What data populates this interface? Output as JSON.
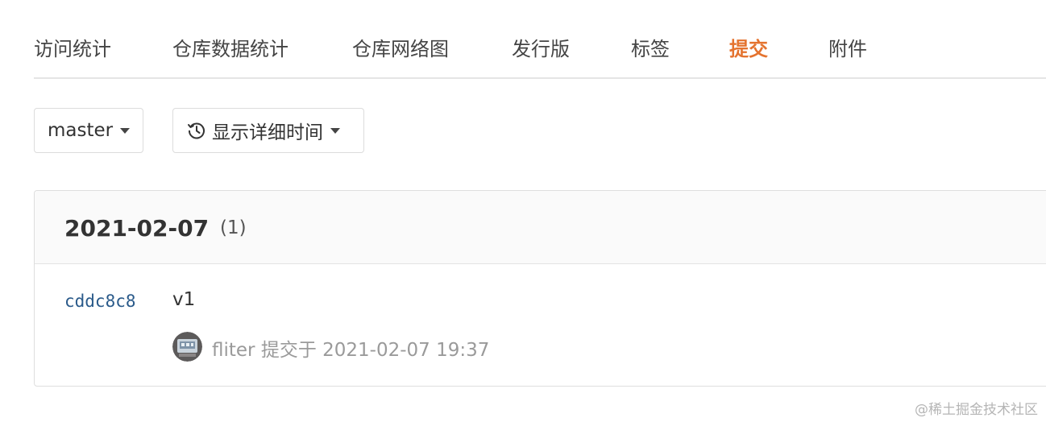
{
  "tabs": [
    {
      "label": "访问统计",
      "active": false
    },
    {
      "label": "仓库数据统计",
      "active": false
    },
    {
      "label": "仓库网络图",
      "active": false
    },
    {
      "label": "发行版",
      "active": false
    },
    {
      "label": "标签",
      "active": false
    },
    {
      "label": "提交",
      "active": true
    },
    {
      "label": "附件",
      "active": false
    }
  ],
  "colors": {
    "accent": "#e4732f",
    "sha": "#2a5a8a",
    "muted": "#9a9a9a"
  },
  "filters": {
    "branch": {
      "value": "master",
      "icon": "caret-down-icon"
    },
    "time": {
      "label": "显示详细时间",
      "icon": "history-clock-icon"
    }
  },
  "commit_group": {
    "date": "2021-02-07",
    "count": "(1)",
    "commits": [
      {
        "sha": "cddc8c8",
        "message": "v1",
        "author": "fliter",
        "action": "提交于",
        "time": "2021-02-07 19:37",
        "avatar_icon": "avatar"
      }
    ]
  },
  "watermark": "@稀土掘金技术社区"
}
